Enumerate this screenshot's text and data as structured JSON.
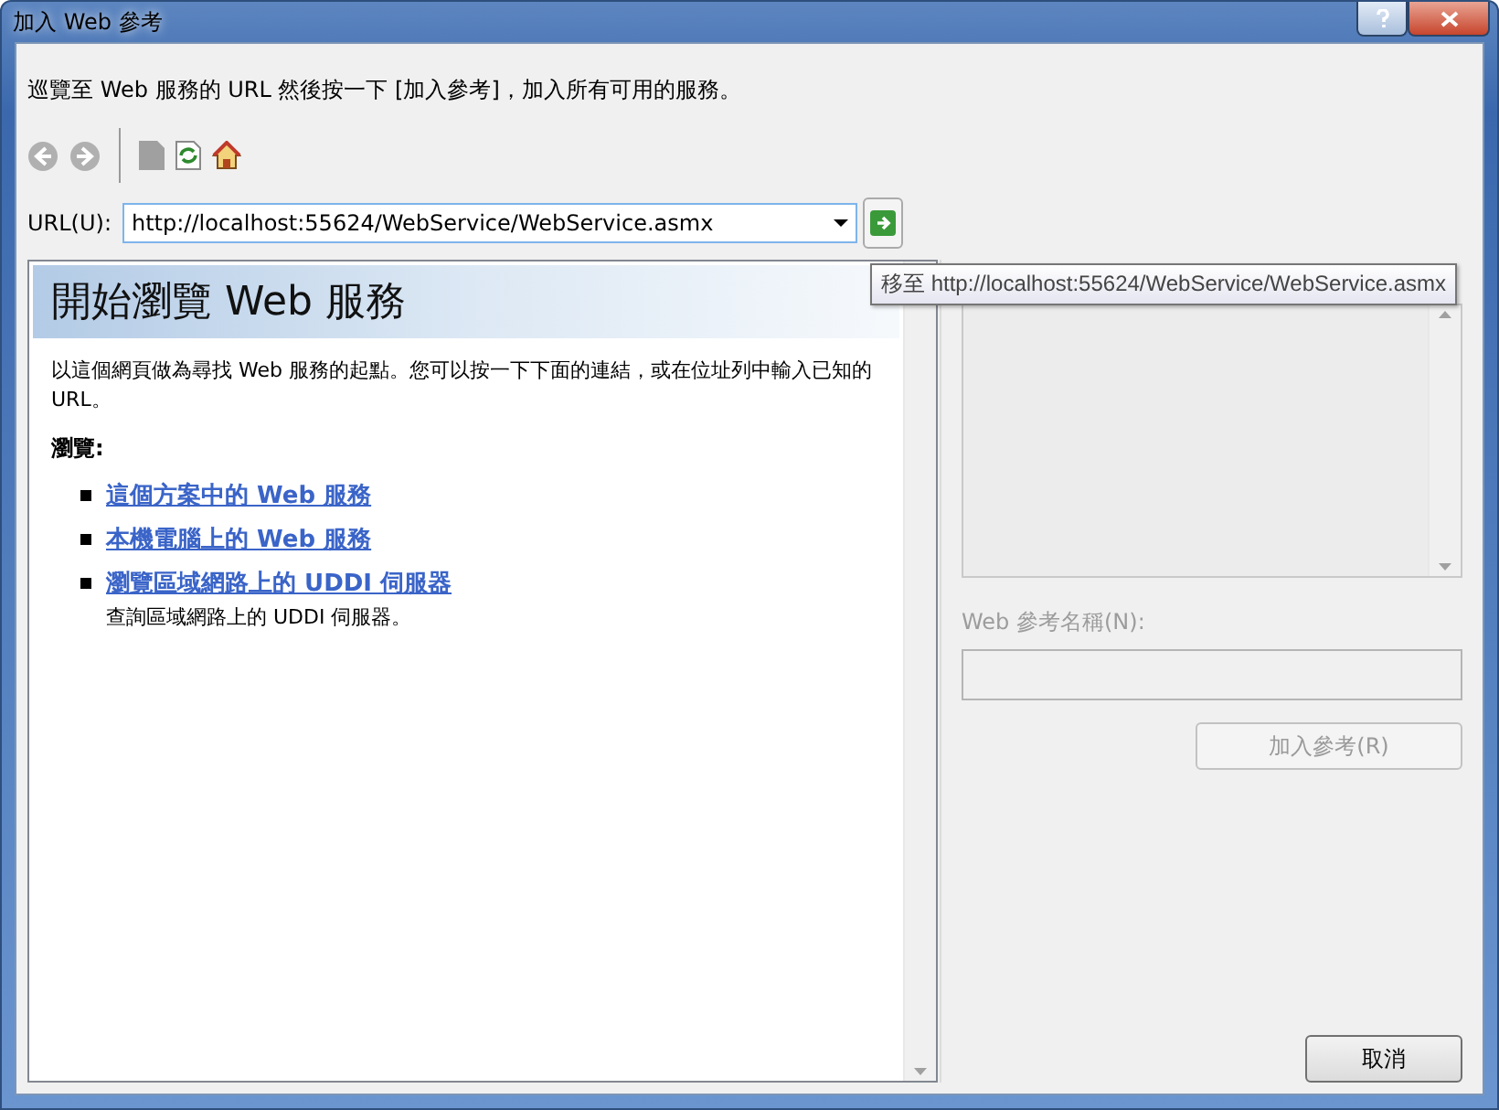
{
  "window": {
    "title": "加入 Web 參考"
  },
  "instructions": "巡覽至 Web 服務的 URL 然後按一下 [加入參考]，加入所有可用的服務。",
  "toolbar": [
    {
      "kind": "back",
      "disabled": true
    },
    {
      "kind": "forward",
      "disabled": true
    },
    {
      "kind": "stop",
      "disabled": true
    },
    {
      "kind": "refresh",
      "disabled": false
    },
    {
      "kind": "home",
      "disabled": false
    }
  ],
  "url": {
    "label": "URL(U):",
    "value": "http://localhost:55624/WebService/WebService.asmx",
    "go_tooltip": "移至 http://localhost:55624/WebService/WebService.asmx"
  },
  "browser": {
    "heading": "開始瀏覽 Web 服務",
    "intro": "以這個網頁做為尋找 Web 服務的起點。您可以按一下下面的連結，或在位址列中輸入已知的 URL。",
    "browse_label": "瀏覽:",
    "links": [
      {
        "text": "這個方案中的 Web 服務"
      },
      {
        "text": "本機電腦上的 Web 服務"
      },
      {
        "text": "瀏覽區域網路上的 UDDI 伺服器",
        "description": "查詢區域網路上的 UDDI 伺服器。"
      }
    ]
  },
  "reference_name": {
    "label": "Web 參考名稱(N):",
    "disabled": true
  },
  "buttons": [
    {
      "label": "加入參考(R)",
      "disabled": true
    },
    {
      "label": "取消",
      "disabled": false
    }
  ]
}
